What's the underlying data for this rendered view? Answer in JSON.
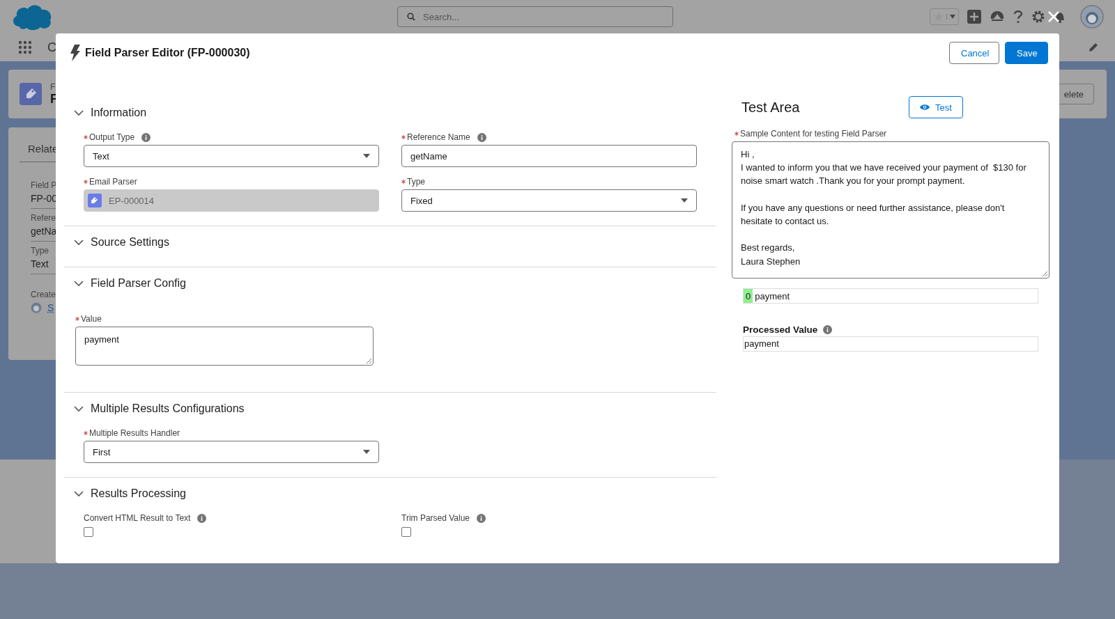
{
  "background": {
    "search": {
      "placeholder": "Search..."
    },
    "app_name": "C",
    "record": {
      "type_label": "F",
      "title": "F"
    },
    "delete_button": "elete",
    "related_tab": "Relate",
    "details": [
      {
        "label": "Field P",
        "value": "FP-00"
      },
      {
        "label": "Refere",
        "value": "getNa"
      },
      {
        "label": "Type",
        "value": "Text"
      }
    ],
    "created_by": {
      "label": "Create",
      "value": "S"
    }
  },
  "modal": {
    "title": "Field Parser Editor (FP-000030)",
    "cancel_button": "Cancel",
    "save_button": "Save",
    "sections": [
      {
        "title": "Information",
        "expanded": true,
        "fields": [
          {
            "kind": "select",
            "label": "Output Type",
            "required": true,
            "info": true,
            "value": "Text"
          },
          {
            "kind": "text",
            "label": "Reference Name",
            "required": true,
            "info": true,
            "value": "getName"
          },
          {
            "kind": "lookup",
            "label": "Email Parser",
            "required": true,
            "value": "EP-000014",
            "disabled": true
          },
          {
            "kind": "select",
            "label": "Type",
            "required": true,
            "value": "Fixed"
          }
        ]
      },
      {
        "title": "Source Settings",
        "expanded": true
      },
      {
        "title": "Field Parser Config",
        "expanded": true,
        "fields": [
          {
            "kind": "textarea",
            "label": "Value",
            "required": true,
            "value": "payment"
          }
        ]
      },
      {
        "title": "Multiple Results Configurations",
        "expanded": true,
        "fields": [
          {
            "kind": "select",
            "label": "Multiple Results Handler",
            "required": true,
            "value": "First"
          }
        ]
      },
      {
        "title": "Results Processing",
        "expanded": true,
        "fields": [
          {
            "kind": "checkbox",
            "label": "Convert HTML Result to Text",
            "required": false,
            "info": true,
            "checked": false
          },
          {
            "kind": "checkbox",
            "label": "Trim Parsed Value",
            "required": false,
            "info": true,
            "checked": false
          }
        ]
      }
    ],
    "test_area": {
      "title": "Test Area",
      "test_button": "Test",
      "sample": {
        "label": "Sample Content for testing Field Parser",
        "required": true,
        "value": "Hi ,\nI wanted to inform you that we have received your payment of  $130 for noise smart watch .Thank you for your prompt payment.\n\nIf you have any questions or need further assistance, please don't hesitate to contact us.\n\nBest regards,\nLaura Stephen"
      },
      "results": [
        {
          "index": "0",
          "value": "payment"
        }
      ],
      "processed": {
        "label": "Processed Value",
        "value": "payment"
      }
    }
  }
}
